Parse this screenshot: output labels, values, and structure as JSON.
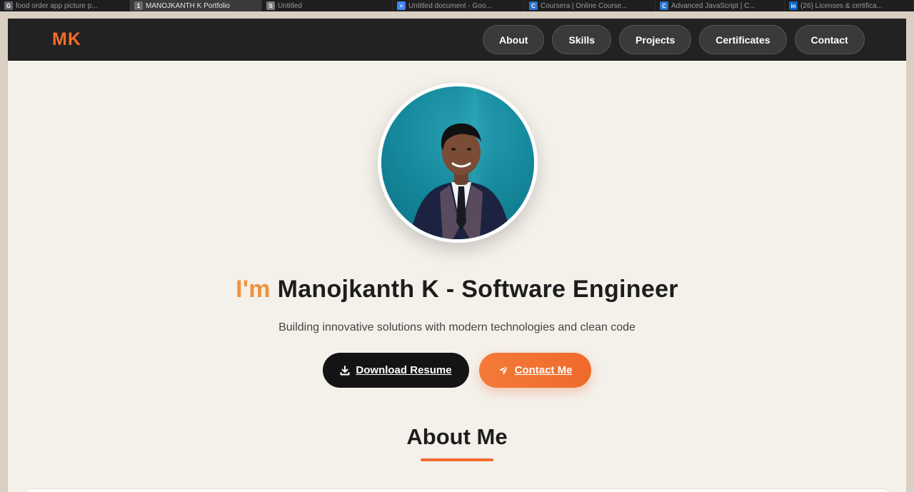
{
  "browser": {
    "tabs": [
      {
        "title": "food order app picture p...",
        "favicon": "G",
        "color": "#5f6368",
        "active": false
      },
      {
        "title": "MANOJKANTH K Portfolio",
        "favicon": "1",
        "color": "#6b6b6b",
        "active": true
      },
      {
        "title": "Untitled",
        "favicon": "S",
        "color": "#7a7a7a",
        "active": false
      },
      {
        "title": "Untitled document - Goo...",
        "favicon": "doc",
        "color": "#4285f4",
        "active": false
      },
      {
        "title": "Coursera | Online Course...",
        "favicon": "C",
        "color": "#2a73cc",
        "active": false
      },
      {
        "title": "Advanced JavaScript | C...",
        "favicon": "C",
        "color": "#2a73cc",
        "active": false
      },
      {
        "title": "(26) Licenses & certifica...",
        "favicon": "in",
        "color": "#0a66c2",
        "active": false
      }
    ]
  },
  "nav": {
    "logo": "MK",
    "links": [
      "About",
      "Skills",
      "Projects",
      "Certificates",
      "Contact"
    ]
  },
  "hero": {
    "title_prefix": "I'm",
    "title_rest": "Manojkanth K - Software Engineer",
    "subtitle": "Building innovative solutions with modern technologies and clean code",
    "download_label": "Download Resume",
    "contact_label": "Contact Me"
  },
  "about": {
    "heading": "About Me"
  },
  "colors": {
    "accent": "#f26b2c",
    "nav_bg": "#222222",
    "page_bg": "#f4f0ea"
  }
}
